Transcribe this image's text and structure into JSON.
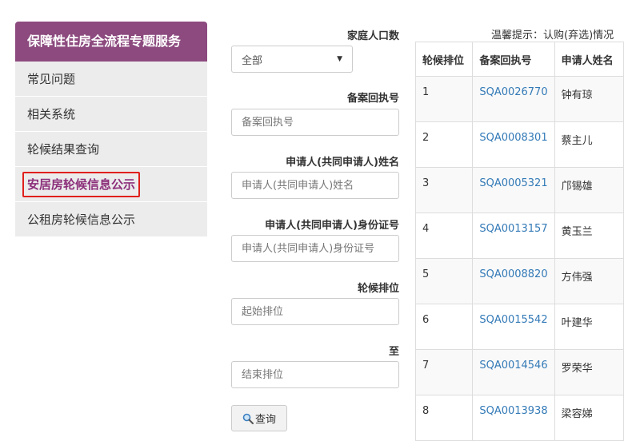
{
  "sidebar": {
    "title": "保障性住房全流程专题服务",
    "items": [
      {
        "label": "常见问题"
      },
      {
        "label": "相关系统"
      },
      {
        "label": "轮候结果查询"
      },
      {
        "label": "安居房轮候信息公示"
      },
      {
        "label": "公租房轮候信息公示"
      }
    ]
  },
  "form": {
    "household_label": "家庭人口数",
    "household_value": "全部",
    "record_label": "备案回执号",
    "record_placeholder": "备案回执号",
    "name_label": "申请人(共同申请人)姓名",
    "name_placeholder": "申请人(共同申请人)姓名",
    "id_label": "申请人(共同申请人)身份证号",
    "id_placeholder": "申请人(共同申请人)身份证号",
    "rank_label": "轮候排位",
    "rank_start_placeholder": "起始排位",
    "to_label": "至",
    "rank_end_placeholder": "结束排位",
    "query_button": "查询"
  },
  "notice": "温馨提示：认购(弃选)情况",
  "table": {
    "headers": [
      "轮候排位",
      "备案回执号",
      "申请人姓名"
    ],
    "rows": [
      {
        "rank": "1",
        "receipt": "SQA0026770",
        "name": "钟有琼"
      },
      {
        "rank": "2",
        "receipt": "SQA0008301",
        "name": "蔡主儿"
      },
      {
        "rank": "3",
        "receipt": "SQA0005321",
        "name": "邝锡雄"
      },
      {
        "rank": "4",
        "receipt": "SQA0013157",
        "name": "黄玉兰"
      },
      {
        "rank": "5",
        "receipt": "SQA0008820",
        "name": "方伟强"
      },
      {
        "rank": "6",
        "receipt": "SQA0015542",
        "name": "叶建华"
      },
      {
        "rank": "7",
        "receipt": "SQA0014546",
        "name": "罗荣华"
      },
      {
        "rank": "8",
        "receipt": "SQA0013938",
        "name": "梁容娣"
      }
    ]
  },
  "colors": {
    "brand": "#8c4a7e",
    "link": "#337ab7",
    "highlight": "#e0201c"
  }
}
